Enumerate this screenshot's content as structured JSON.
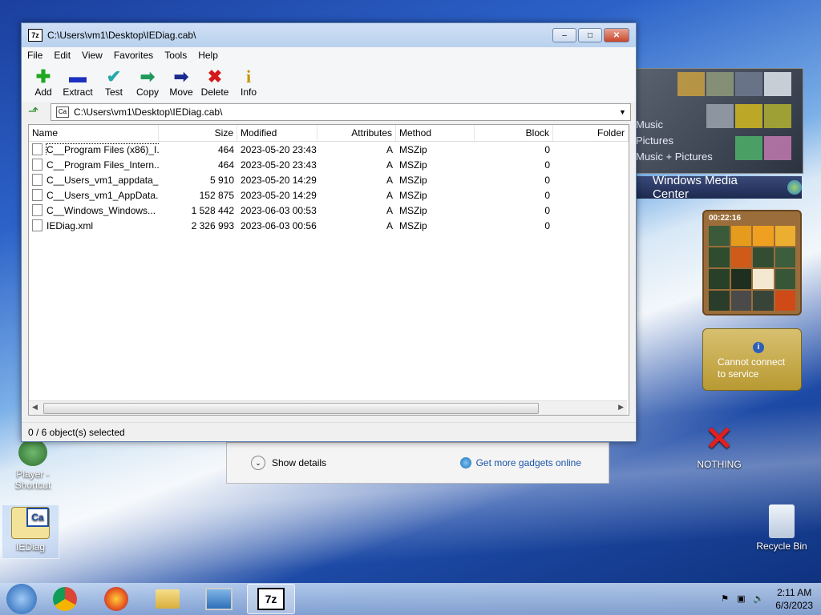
{
  "window": {
    "title": "C:\\Users\\vm1\\Desktop\\IEDiag.cab\\",
    "caption_buttons": {
      "minimize": "–",
      "maximize": "□",
      "close": "✕"
    },
    "app_icon": "7z"
  },
  "menu": [
    "File",
    "Edit",
    "View",
    "Favorites",
    "Tools",
    "Help"
  ],
  "toolbar": [
    {
      "label": "Add",
      "icon": "plus-icon",
      "glyph": "✚",
      "color": "#1fa81f"
    },
    {
      "label": "Extract",
      "icon": "minus-icon",
      "glyph": "▬",
      "color": "#1c2fbf"
    },
    {
      "label": "Test",
      "icon": "check-icon",
      "glyph": "✔",
      "color": "#25a9a9"
    },
    {
      "label": "Copy",
      "icon": "arrow-right-icon",
      "glyph": "➡",
      "color": "#1e9a5a"
    },
    {
      "label": "Move",
      "icon": "arrow-right-icon",
      "glyph": "➡",
      "color": "#1a2c8f"
    },
    {
      "label": "Delete",
      "icon": "x-icon",
      "glyph": "✖",
      "color": "#d21a1a"
    },
    {
      "label": "Info",
      "icon": "info-icon",
      "glyph": "i",
      "color": "#c89400"
    }
  ],
  "address": {
    "path": "C:\\Users\\vm1\\Desktop\\IEDiag.cab\\",
    "icon": "Ca"
  },
  "columns": [
    "Name",
    "Size",
    "Modified",
    "Attributes",
    "Method",
    "Block",
    "Folder"
  ],
  "files": [
    {
      "name": "C__Program Files (x86)_I...",
      "size": "464",
      "modified": "2023-05-20 23:43",
      "attributes": "A",
      "method": "MSZip",
      "block": "0",
      "folder": "",
      "selected": true
    },
    {
      "name": "C__Program Files_Intern...",
      "size": "464",
      "modified": "2023-05-20 23:43",
      "attributes": "A",
      "method": "MSZip",
      "block": "0",
      "folder": ""
    },
    {
      "name": "C__Users_vm1_appdata_...",
      "size": "5 910",
      "modified": "2023-05-20 14:29",
      "attributes": "A",
      "method": "MSZip",
      "block": "0",
      "folder": ""
    },
    {
      "name": "C__Users_vm1_AppData...",
      "size": "152 875",
      "modified": "2023-05-20 14:29",
      "attributes": "A",
      "method": "MSZip",
      "block": "0",
      "folder": ""
    },
    {
      "name": "C__Windows_Windows...",
      "size": "1 528 442",
      "modified": "2023-06-03 00:53",
      "attributes": "A",
      "method": "MSZip",
      "block": "0",
      "folder": ""
    },
    {
      "name": "IEDiag.xml",
      "size": "2 326 993",
      "modified": "2023-06-03 00:56",
      "attributes": "A",
      "method": "MSZip",
      "block": "0",
      "folder": ""
    }
  ],
  "status": "0 / 6 object(s) selected",
  "gadgets": {
    "media_center": {
      "items": [
        "Music",
        "Pictures",
        "Music + Pictures"
      ],
      "title": "Windows Media Center"
    },
    "puzzle": {
      "time": "00:22:16"
    },
    "weather": {
      "message": "Cannot connect to service"
    },
    "panel": {
      "show_details": "Show details",
      "get_more": "Get more gadgets online"
    }
  },
  "desktop": {
    "icons": [
      {
        "label": "Player - Shortcut"
      },
      {
        "label": "IEDiag"
      },
      {
        "label": "NOTHING"
      },
      {
        "label": "Recycle Bin"
      }
    ]
  },
  "taskbar": {
    "apps": [
      "chrome",
      "firefox",
      "file-explorer",
      "remote-desktop",
      "7zip"
    ],
    "active_app": "7z",
    "clock_time": "2:11 AM",
    "clock_date": "6/3/2023"
  }
}
